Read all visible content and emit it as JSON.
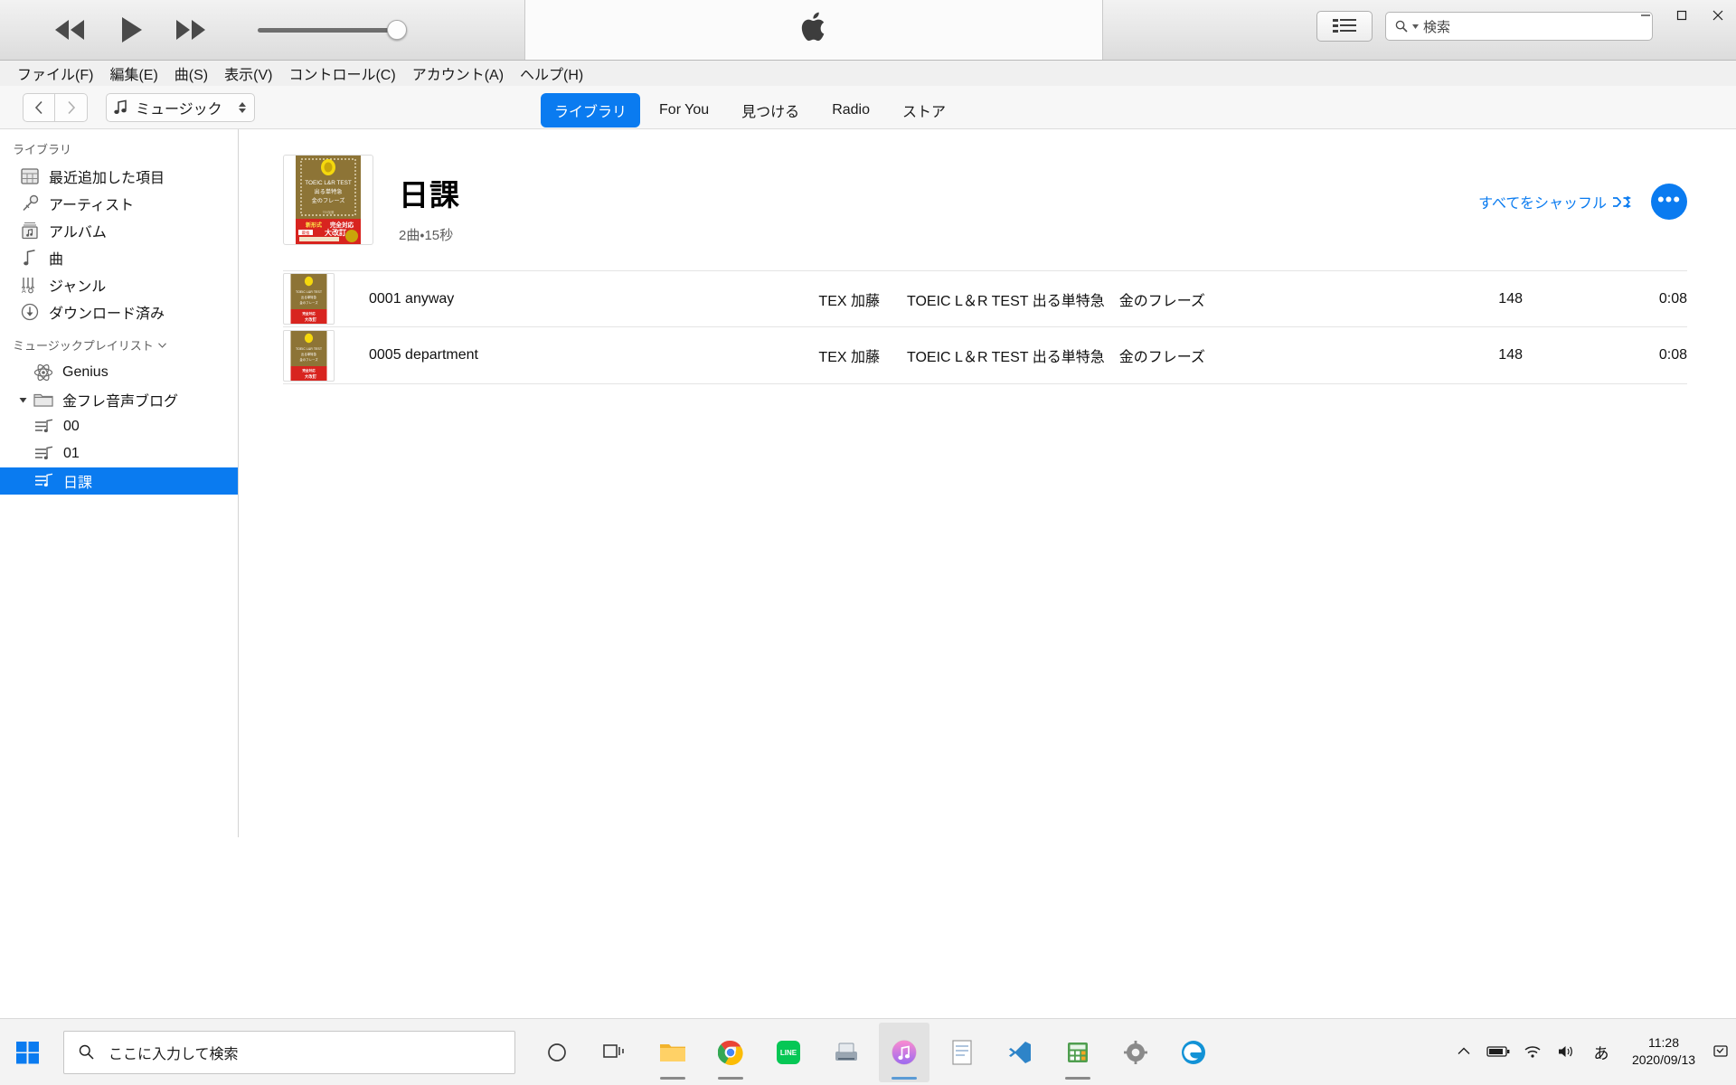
{
  "window": {
    "minimize": "–",
    "maximize": "▫",
    "close": "✕"
  },
  "player": {
    "rewind_icon": "rewind-icon",
    "play_icon": "play-icon",
    "forward_icon": "fast-forward-icon",
    "volume_value": 92,
    "apple_logo": "",
    "songlist_icon": "song-list-icon",
    "search_placeholder": "検索",
    "search_value": "",
    "search_icon": "search-icon"
  },
  "menubar": {
    "items": [
      {
        "label": "ファイル(F)"
      },
      {
        "label": "編集(E)"
      },
      {
        "label": "曲(S)"
      },
      {
        "label": "表示(V)"
      },
      {
        "label": "コントロール(C)"
      },
      {
        "label": "アカウント(A)"
      },
      {
        "label": "ヘルプ(H)"
      }
    ]
  },
  "nav": {
    "back_icon": "chevron-left-icon",
    "forward_icon": "chevron-right-icon",
    "library_picker": {
      "icon": "music-note-icon",
      "label": "ミュージック",
      "chevron": "up-down-chevron-icon"
    },
    "tabs": [
      {
        "label": "ライブラリ",
        "active": true
      },
      {
        "label": "For You",
        "active": false
      },
      {
        "label": "見つける",
        "active": false
      },
      {
        "label": "Radio",
        "active": false
      },
      {
        "label": "ストア",
        "active": false
      }
    ]
  },
  "sidebar": {
    "library_header": "ライブラリ",
    "library_items": [
      {
        "label": "最近追加した項目",
        "icon": "recently-added-grid-icon"
      },
      {
        "label": "アーティスト",
        "icon": "microphone-icon"
      },
      {
        "label": "アルバム",
        "icon": "album-icon"
      },
      {
        "label": "曲",
        "icon": "music-note-icon"
      },
      {
        "label": "ジャンル",
        "icon": "genre-icon"
      },
      {
        "label": "ダウンロード済み",
        "icon": "download-circle-icon"
      }
    ],
    "playlists_header": "ミュージックプレイリスト",
    "playlists_chevron": "chevron-down-icon",
    "playlist_items": [
      {
        "label": "Genius",
        "icon": "genius-atom-icon",
        "selected": false,
        "child": false,
        "folder": false
      },
      {
        "label": "金フレ音声ブログ",
        "icon": "folder-icon",
        "selected": false,
        "child": false,
        "folder": true,
        "expanded": true
      },
      {
        "label": "00",
        "icon": "playlist-icon",
        "selected": false,
        "child": true,
        "folder": false
      },
      {
        "label": "01",
        "icon": "playlist-icon",
        "selected": false,
        "child": true,
        "folder": false
      },
      {
        "label": "日課",
        "icon": "playlist-icon",
        "selected": true,
        "child": true,
        "folder": false
      }
    ]
  },
  "album_header": {
    "title": "日課",
    "subtitle": "2曲・15秒",
    "artwork": {
      "alt": "TOEIC L&R TEST 出る単特急 金のフレーズ",
      "line1": "TOEIC L&R TEST",
      "line2": "出る単特急",
      "line3": "金のフレーズ",
      "badge": "新形式完全対応",
      "banner": "最強 大改訂"
    },
    "shuffle_label": "すべてをシャッフル",
    "shuffle_icon": "shuffle-icon",
    "more_label": "•••",
    "accent_color": "#0a7bf0"
  },
  "tracks": [
    {
      "title": "0001 anyway",
      "artist": "TEX 加藤",
      "album": "TOEIC L＆R TEST 出る単特急　金のフレーズ",
      "bpm": "148",
      "time": "0:08"
    },
    {
      "title": "0005 department",
      "artist": "TEX 加藤",
      "album": "TOEIC L＆R TEST 出る単特急　金のフレーズ",
      "bpm": "148",
      "time": "0:08"
    }
  ],
  "taskbar": {
    "start_icon": "windows-start-icon",
    "search_placeholder": "ここに入力して検索",
    "search_icon": "search-icon",
    "items": [
      {
        "name": "cortana-icon",
        "running": false
      },
      {
        "name": "task-view-icon",
        "running": false
      },
      {
        "name": "file-explorer-icon",
        "running": true
      },
      {
        "name": "chrome-icon",
        "running": true
      },
      {
        "name": "line-icon",
        "running": false
      },
      {
        "name": "scanner-icon",
        "running": false
      },
      {
        "name": "itunes-icon",
        "running": true,
        "active": true
      },
      {
        "name": "notepad-icon",
        "running": false
      },
      {
        "name": "vscode-icon",
        "running": false
      },
      {
        "name": "calculator-icon",
        "running": true
      },
      {
        "name": "settings-icon",
        "running": false
      },
      {
        "name": "edge-icon",
        "running": false
      }
    ],
    "tray": {
      "chevron_icon": "show-hidden-icons-icon",
      "battery_icon": "battery-icon",
      "network_icon": "wifi-icon",
      "volume_icon": "speaker-icon",
      "ime_label": "あ",
      "time": "11:28",
      "date": "2020/09/13",
      "show_desktop": "show-desktop-icon"
    }
  }
}
